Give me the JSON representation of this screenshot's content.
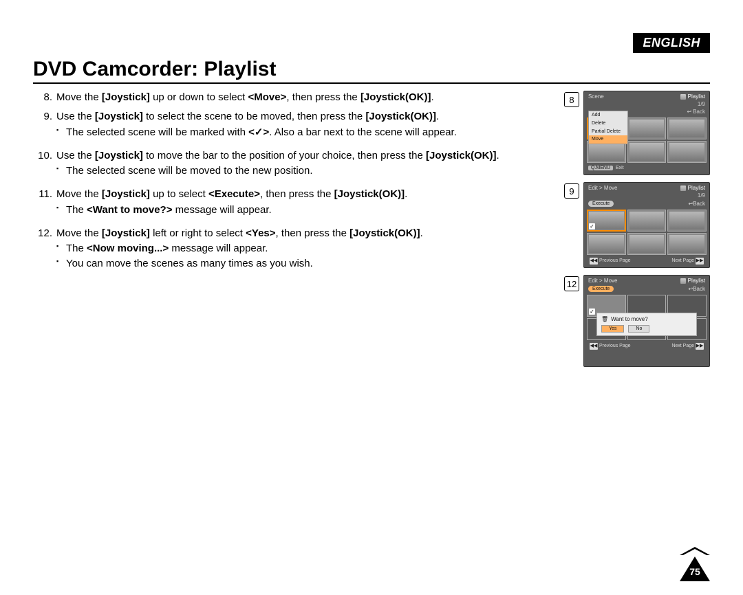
{
  "language_badge": "ENGLISH",
  "title": "DVD Camcorder: Playlist",
  "page_number": "75",
  "steps": [
    {
      "num": "8.",
      "text_parts": [
        "Move the ",
        "[Joystick]",
        " up or down to select ",
        "<Move>",
        ", then press the ",
        "[Joystick(OK)]",
        "."
      ]
    },
    {
      "num": "9.",
      "text_parts": [
        "Use the ",
        "[Joystick]",
        " to select the scene to be moved, then press the ",
        "[Joystick(OK)]",
        "."
      ],
      "sub": [
        "The selected scene will be marked with <✓>. Also a bar next to the scene will appear."
      ]
    },
    {
      "num": "10.",
      "text_parts": [
        "Use the ",
        "[Joystick]",
        " to move the bar to the position of your choice, then press the ",
        "[Joystick(OK)]",
        "."
      ],
      "sub": [
        "The selected scene will be moved to the new position."
      ]
    },
    {
      "num": "11.",
      "text_parts": [
        "Move the ",
        "[Joystick]",
        " up to select ",
        "<Execute>",
        ", then press the ",
        "[Joystick(OK)]",
        "."
      ],
      "sub": [
        "The <Want to move?> message will appear."
      ]
    },
    {
      "num": "12.",
      "text_parts": [
        "Move the ",
        "[Joystick]",
        " left or right to select ",
        "<Yes>",
        ", then press the ",
        "[Joystick(OK)]",
        "."
      ],
      "sub": [
        "The <Now moving...> message will appear.",
        "You can move the scenes as many times as you wish."
      ]
    }
  ],
  "figures": {
    "fig8": {
      "num": "8",
      "header_left": "Scene",
      "header_right": "Playlist",
      "counter": "1/9",
      "back": "Back",
      "menu": [
        "Add",
        "Delete",
        "Partial Delete",
        "Move"
      ],
      "menu_highlight_index": 3,
      "qmenu": "Q.MENU",
      "exit": "Exit"
    },
    "fig9": {
      "num": "9",
      "header_left": "Edit > Move",
      "header_right": "Playlist",
      "counter": "1/9",
      "back": "Back",
      "execute": "Execute",
      "prev": "Previous Page",
      "next": "Next Page"
    },
    "fig12": {
      "num": "12",
      "header_left": "Edit > Move",
      "header_right": "Playlist",
      "back": "Back",
      "execute": "Execute",
      "dialog_q": "Want to move?",
      "yes": "Yes",
      "no": "No",
      "prev": "Previous Page",
      "next": "Next Page"
    }
  }
}
